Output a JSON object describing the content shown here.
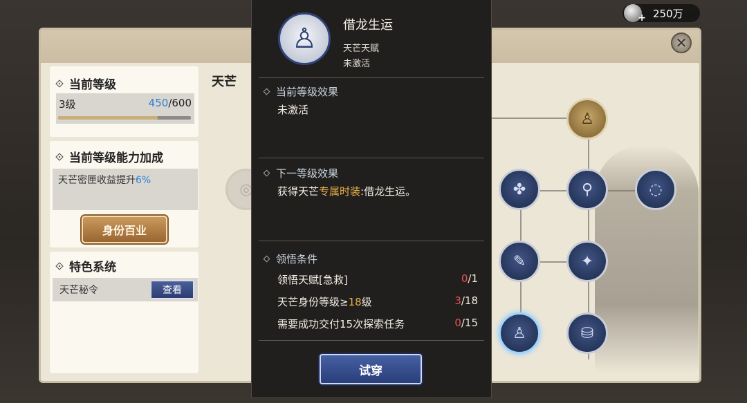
{
  "currency": {
    "amount": "250万"
  },
  "left": {
    "level": {
      "title": "当前等级",
      "level_text": "3级",
      "current_exp": "450",
      "max_exp": "/600",
      "progress": 0.75
    },
    "bonus": {
      "title": "当前等级能力加成",
      "text": "天芒密匣收益提升",
      "percent": "6%"
    },
    "identity_button": "身份百业",
    "system": {
      "title": "特色系统",
      "item": "天芒秘令",
      "view_label": "查看"
    }
  },
  "tab_title": "天芒",
  "tooltip": {
    "name": "借龙生运",
    "type": "天芒天赋",
    "status": "未激活",
    "current_effect_title": "当前等级效果",
    "current_effect_text": "未激活",
    "next_effect_title": "下一等级效果",
    "next_effect_prefix": "获得天芒",
    "next_effect_highlight": "专属时装",
    "next_effect_suffix": ":借龙生运。",
    "conditions_title": "领悟条件",
    "conditions": [
      {
        "label": "领悟天赋[急救]",
        "progress": "0",
        "total": "/1"
      },
      {
        "label_prefix": "天芒身份等级≥",
        "label_highlight": "18",
        "label_suffix": "级",
        "progress": "3",
        "total": "/18"
      },
      {
        "label": "需要成功交付15次探索任务",
        "progress": "0",
        "total": "/15"
      }
    ],
    "try_button": "试穿"
  },
  "colors": {
    "accent_blue": "#2b7fd4",
    "gold_text": "#e9b04a",
    "red_text": "#e45454"
  }
}
